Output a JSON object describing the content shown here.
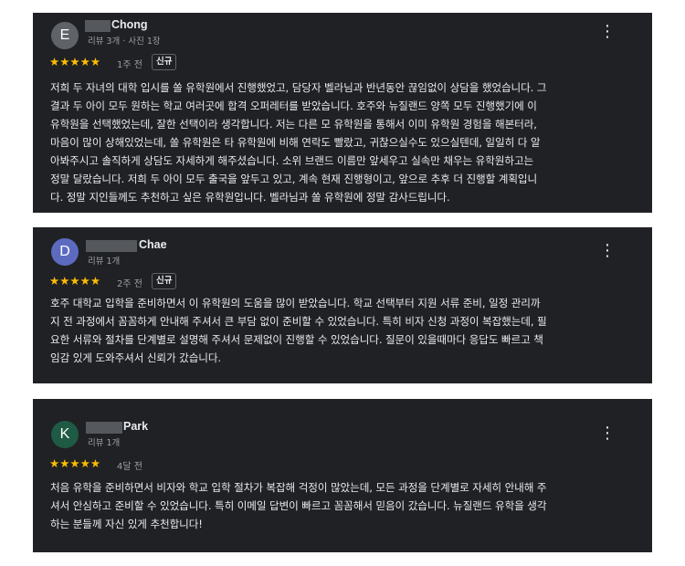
{
  "reviews": [
    {
      "avatar_letter": "E",
      "avatar_color": "#5f6368",
      "name": "Chong",
      "meta": "리뷰 3개 · 사진 1장",
      "stars": "★★★★★",
      "time": "1주 전",
      "badge": "신규",
      "body_lines": [
        "저희 두 자녀의 대학 입시를 쏠 유학원에서 진행했었고, 담당자 벨라님과 반년동안 끊임없이 상담을 했었습니다. 그",
        "결과 두 아이 모두 원하는 학교 여러곳에 합격 오퍼레터를 받았습니다. 호주와 뉴질랜드 양쪽 모두 진행했기에 이",
        "유학원을 선택했었는데, 잘한 선택이라 생각합니다. 저는 다른 모 유학원을 통해서 이미 유학원 경험을 해본터라,",
        "마음이 많이 상해있었는데, 쏠 유학원은 타 유학원에 비해 연락도 빨랐고, 귀찮으실수도 있으실텐데, 일일히 다 알",
        "아봐주시고 솔직하게 상담도 자세하게 해주셨습니다. 소위 브랜드 이름만 앞세우고 실속만 채우는 유학원하고는",
        "정말 달랐습니다. 저희 두 아이 모두 출국을 앞두고 있고, 계속 현재 진행형이고, 앞으로 추후 더 진행할 계획입니",
        "다. 정말 지인들께도 추천하고 싶은 유학원입니다. 벨라님과 쏠 유학원에 정말 감사드립니다."
      ]
    },
    {
      "avatar_letter": "D",
      "avatar_color": "#5c6bc0",
      "name": "Chae",
      "meta": "리뷰 1개",
      "stars": "★★★★★",
      "time": "2주 전",
      "badge": "신규",
      "body_lines": [
        "호주 대학교 입학을 준비하면서 이 유학원의 도움을 많이 받았습니다. 학교 선택부터 지원 서류 준비, 일정 관리까",
        "지 전 과정에서 꼼꼼하게 안내해 주셔서 큰 부담 없이 준비할 수 있었습니다. 특히 비자 신청 과정이 복잡했는데, 필",
        "요한 서류와 절차를 단계별로 설명해 주셔서 문제없이 진행할 수 있었습니다. 질문이 있을때마다 응답도 빠르고 책",
        "임감 있게 도와주셔서 신뢰가 갔습니다."
      ]
    },
    {
      "avatar_letter": "K",
      "avatar_color": "#1e5a44",
      "name": "Park",
      "meta": "리뷰 1개",
      "stars": "★★★★★",
      "time": "4달 전",
      "badge": "",
      "body_lines": [
        "처음 유학을 준비하면서 비자와 학교 입학 절차가 복잡해 걱정이 많았는데, 모든 과정을 단계별로 자세히 안내해 주",
        "셔서 안심하고 준비할 수 있었습니다. 특히 이메일 답변이 빠르고 꼼꼼해서 믿음이 갔습니다. 뉴질랜드 유학을 생각",
        "하는 분들께 자신 있게 추천합니다!"
      ]
    }
  ],
  "more_icon": "more-vert-icon"
}
